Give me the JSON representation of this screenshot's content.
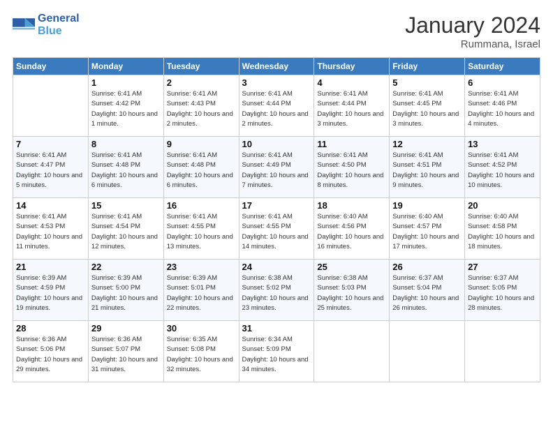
{
  "header": {
    "logo_line1": "General",
    "logo_line2": "Blue",
    "month_title": "January 2024",
    "location": "Rummana, Israel"
  },
  "weekdays": [
    "Sunday",
    "Monday",
    "Tuesday",
    "Wednesday",
    "Thursday",
    "Friday",
    "Saturday"
  ],
  "weeks": [
    [
      {
        "day": "",
        "sunrise": "",
        "sunset": "",
        "daylight": ""
      },
      {
        "day": "1",
        "sunrise": "Sunrise: 6:41 AM",
        "sunset": "Sunset: 4:42 PM",
        "daylight": "Daylight: 10 hours and 1 minute."
      },
      {
        "day": "2",
        "sunrise": "Sunrise: 6:41 AM",
        "sunset": "Sunset: 4:43 PM",
        "daylight": "Daylight: 10 hours and 2 minutes."
      },
      {
        "day": "3",
        "sunrise": "Sunrise: 6:41 AM",
        "sunset": "Sunset: 4:44 PM",
        "daylight": "Daylight: 10 hours and 2 minutes."
      },
      {
        "day": "4",
        "sunrise": "Sunrise: 6:41 AM",
        "sunset": "Sunset: 4:44 PM",
        "daylight": "Daylight: 10 hours and 3 minutes."
      },
      {
        "day": "5",
        "sunrise": "Sunrise: 6:41 AM",
        "sunset": "Sunset: 4:45 PM",
        "daylight": "Daylight: 10 hours and 3 minutes."
      },
      {
        "day": "6",
        "sunrise": "Sunrise: 6:41 AM",
        "sunset": "Sunset: 4:46 PM",
        "daylight": "Daylight: 10 hours and 4 minutes."
      }
    ],
    [
      {
        "day": "7",
        "sunrise": "Sunrise: 6:41 AM",
        "sunset": "Sunset: 4:47 PM",
        "daylight": "Daylight: 10 hours and 5 minutes."
      },
      {
        "day": "8",
        "sunrise": "Sunrise: 6:41 AM",
        "sunset": "Sunset: 4:48 PM",
        "daylight": "Daylight: 10 hours and 6 minutes."
      },
      {
        "day": "9",
        "sunrise": "Sunrise: 6:41 AM",
        "sunset": "Sunset: 4:48 PM",
        "daylight": "Daylight: 10 hours and 6 minutes."
      },
      {
        "day": "10",
        "sunrise": "Sunrise: 6:41 AM",
        "sunset": "Sunset: 4:49 PM",
        "daylight": "Daylight: 10 hours and 7 minutes."
      },
      {
        "day": "11",
        "sunrise": "Sunrise: 6:41 AM",
        "sunset": "Sunset: 4:50 PM",
        "daylight": "Daylight: 10 hours and 8 minutes."
      },
      {
        "day": "12",
        "sunrise": "Sunrise: 6:41 AM",
        "sunset": "Sunset: 4:51 PM",
        "daylight": "Daylight: 10 hours and 9 minutes."
      },
      {
        "day": "13",
        "sunrise": "Sunrise: 6:41 AM",
        "sunset": "Sunset: 4:52 PM",
        "daylight": "Daylight: 10 hours and 10 minutes."
      }
    ],
    [
      {
        "day": "14",
        "sunrise": "Sunrise: 6:41 AM",
        "sunset": "Sunset: 4:53 PM",
        "daylight": "Daylight: 10 hours and 11 minutes."
      },
      {
        "day": "15",
        "sunrise": "Sunrise: 6:41 AM",
        "sunset": "Sunset: 4:54 PM",
        "daylight": "Daylight: 10 hours and 12 minutes."
      },
      {
        "day": "16",
        "sunrise": "Sunrise: 6:41 AM",
        "sunset": "Sunset: 4:55 PM",
        "daylight": "Daylight: 10 hours and 13 minutes."
      },
      {
        "day": "17",
        "sunrise": "Sunrise: 6:41 AM",
        "sunset": "Sunset: 4:55 PM",
        "daylight": "Daylight: 10 hours and 14 minutes."
      },
      {
        "day": "18",
        "sunrise": "Sunrise: 6:40 AM",
        "sunset": "Sunset: 4:56 PM",
        "daylight": "Daylight: 10 hours and 16 minutes."
      },
      {
        "day": "19",
        "sunrise": "Sunrise: 6:40 AM",
        "sunset": "Sunset: 4:57 PM",
        "daylight": "Daylight: 10 hours and 17 minutes."
      },
      {
        "day": "20",
        "sunrise": "Sunrise: 6:40 AM",
        "sunset": "Sunset: 4:58 PM",
        "daylight": "Daylight: 10 hours and 18 minutes."
      }
    ],
    [
      {
        "day": "21",
        "sunrise": "Sunrise: 6:39 AM",
        "sunset": "Sunset: 4:59 PM",
        "daylight": "Daylight: 10 hours and 19 minutes."
      },
      {
        "day": "22",
        "sunrise": "Sunrise: 6:39 AM",
        "sunset": "Sunset: 5:00 PM",
        "daylight": "Daylight: 10 hours and 21 minutes."
      },
      {
        "day": "23",
        "sunrise": "Sunrise: 6:39 AM",
        "sunset": "Sunset: 5:01 PM",
        "daylight": "Daylight: 10 hours and 22 minutes."
      },
      {
        "day": "24",
        "sunrise": "Sunrise: 6:38 AM",
        "sunset": "Sunset: 5:02 PM",
        "daylight": "Daylight: 10 hours and 23 minutes."
      },
      {
        "day": "25",
        "sunrise": "Sunrise: 6:38 AM",
        "sunset": "Sunset: 5:03 PM",
        "daylight": "Daylight: 10 hours and 25 minutes."
      },
      {
        "day": "26",
        "sunrise": "Sunrise: 6:37 AM",
        "sunset": "Sunset: 5:04 PM",
        "daylight": "Daylight: 10 hours and 26 minutes."
      },
      {
        "day": "27",
        "sunrise": "Sunrise: 6:37 AM",
        "sunset": "Sunset: 5:05 PM",
        "daylight": "Daylight: 10 hours and 28 minutes."
      }
    ],
    [
      {
        "day": "28",
        "sunrise": "Sunrise: 6:36 AM",
        "sunset": "Sunset: 5:06 PM",
        "daylight": "Daylight: 10 hours and 29 minutes."
      },
      {
        "day": "29",
        "sunrise": "Sunrise: 6:36 AM",
        "sunset": "Sunset: 5:07 PM",
        "daylight": "Daylight: 10 hours and 31 minutes."
      },
      {
        "day": "30",
        "sunrise": "Sunrise: 6:35 AM",
        "sunset": "Sunset: 5:08 PM",
        "daylight": "Daylight: 10 hours and 32 minutes."
      },
      {
        "day": "31",
        "sunrise": "Sunrise: 6:34 AM",
        "sunset": "Sunset: 5:09 PM",
        "daylight": "Daylight: 10 hours and 34 minutes."
      },
      {
        "day": "",
        "sunrise": "",
        "sunset": "",
        "daylight": ""
      },
      {
        "day": "",
        "sunrise": "",
        "sunset": "",
        "daylight": ""
      },
      {
        "day": "",
        "sunrise": "",
        "sunset": "",
        "daylight": ""
      }
    ]
  ]
}
